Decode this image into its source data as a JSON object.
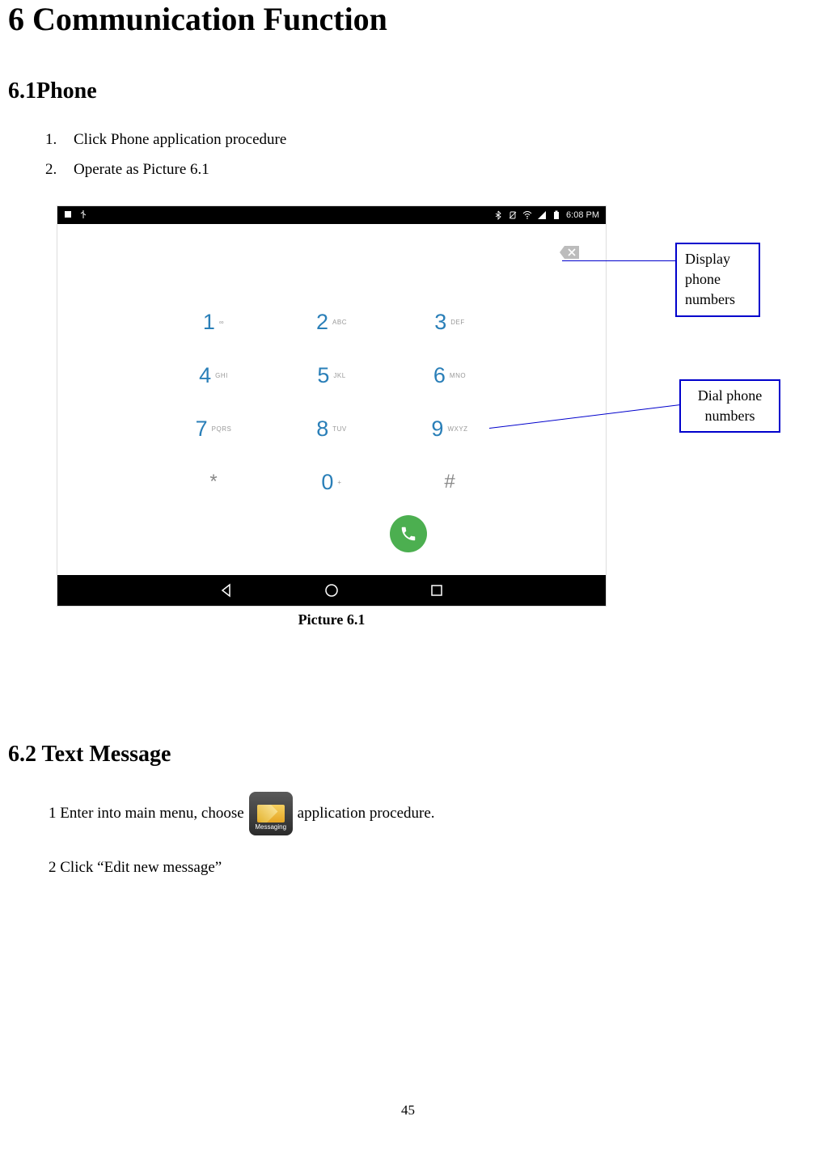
{
  "chapter_title": "6 Communication Function",
  "section_phone_title": "6.1Phone",
  "phone_steps": [
    "Click Phone application procedure",
    "Operate as Picture 6.1"
  ],
  "figure_caption": "Picture 6.1",
  "callouts": {
    "display": "Display phone numbers",
    "dial": "Dial phone numbers"
  },
  "status_bar": {
    "time": "6:08 PM",
    "battery_label": "battery",
    "signal_label": "signal",
    "wifi_label": "wifi",
    "bt_label": "bluetooth"
  },
  "keypad": [
    [
      {
        "digit": "1",
        "letters": "∞"
      },
      {
        "digit": "2",
        "letters": "ABC"
      },
      {
        "digit": "3",
        "letters": "DEF"
      }
    ],
    [
      {
        "digit": "4",
        "letters": "GHI"
      },
      {
        "digit": "5",
        "letters": "JKL"
      },
      {
        "digit": "6",
        "letters": "MNO"
      }
    ],
    [
      {
        "digit": "7",
        "letters": "PQRS"
      },
      {
        "digit": "8",
        "letters": "TUV"
      },
      {
        "digit": "9",
        "letters": "WXYZ"
      }
    ],
    [
      {
        "digit": "*",
        "letters": ""
      },
      {
        "digit": "0",
        "letters": "+"
      },
      {
        "digit": "#",
        "letters": ""
      }
    ]
  ],
  "section_text_title": "6.2 Text Message",
  "text_steps": {
    "step1_pre": "1 Enter into main menu, choose",
    "step1_post": "application procedure.",
    "step2": "2 Click “Edit new message”"
  },
  "messaging_icon_label": "Messaging",
  "page_number": "45"
}
